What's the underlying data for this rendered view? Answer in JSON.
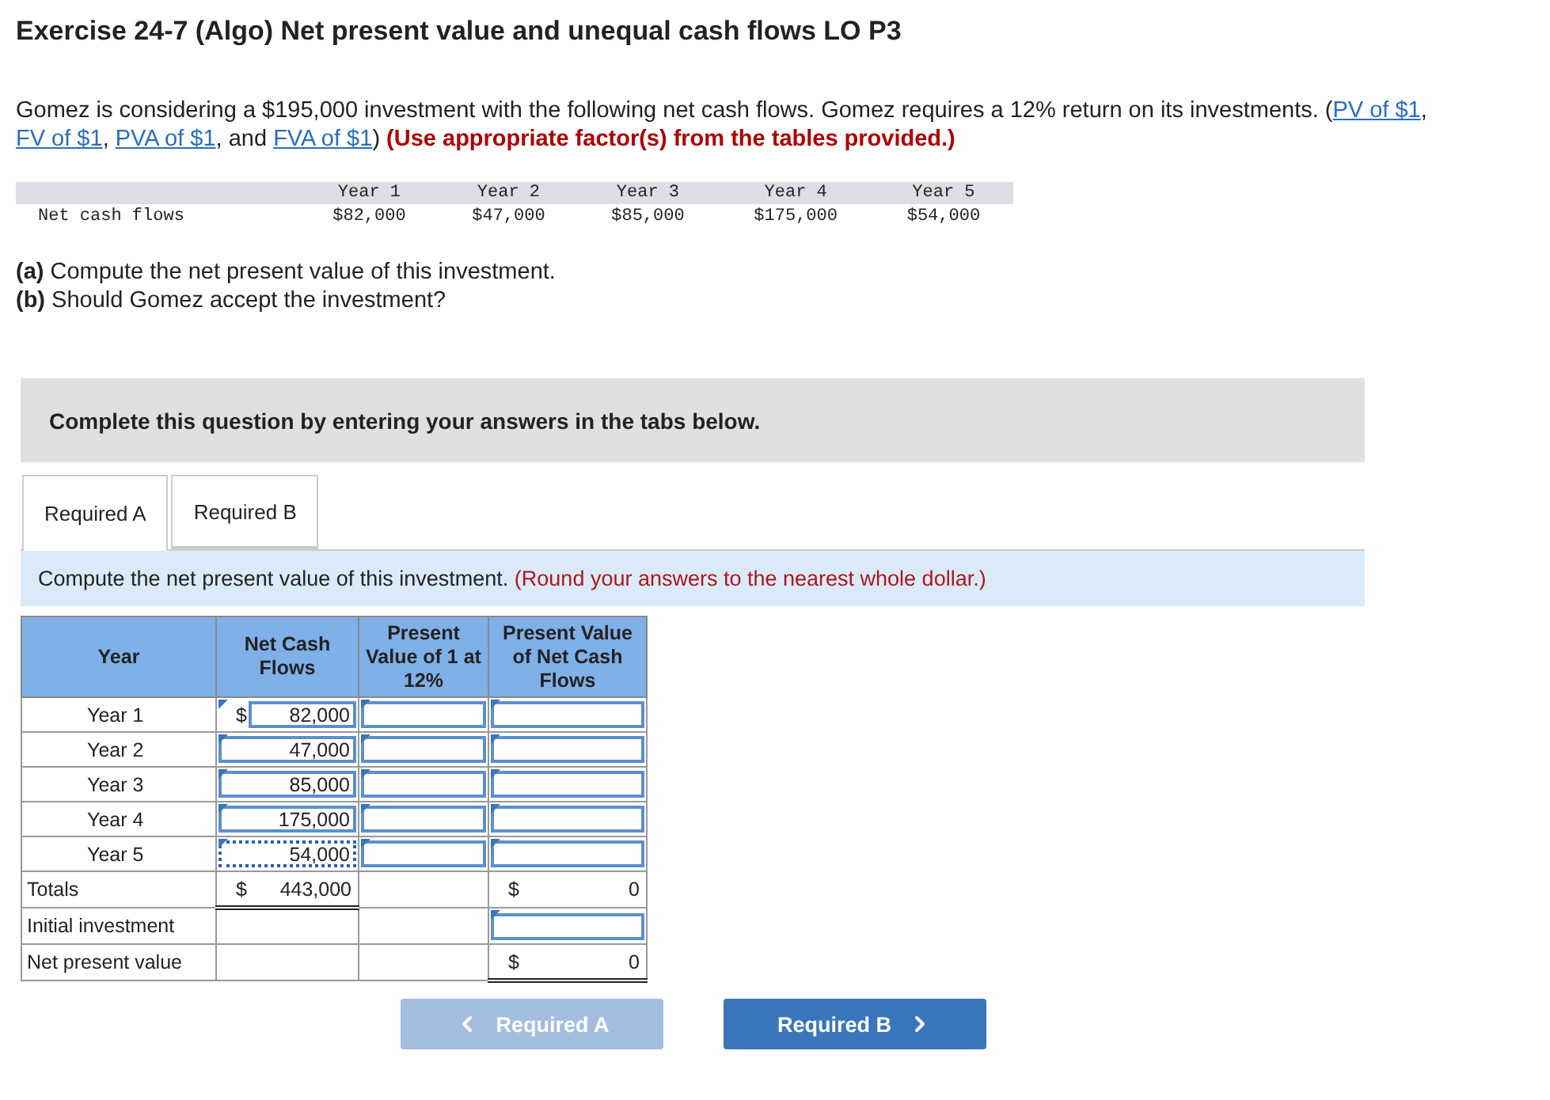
{
  "title": "Exercise 24-7 (Algo) Net present value and unequal cash flows LO P3",
  "intro": [
    {
      "kind": "text",
      "text": "Gomez is considering a $195,000 investment with the following net cash flows. Gomez requires a 12% return on its investments. ("
    },
    {
      "kind": "link",
      "text": "PV of $1"
    },
    {
      "kind": "text",
      "text": ", "
    },
    {
      "kind": "link",
      "text": "FV of $1"
    },
    {
      "kind": "text",
      "text": ", "
    },
    {
      "kind": "link",
      "text": "PVA of $1"
    },
    {
      "kind": "text",
      "text": ", and "
    },
    {
      "kind": "link",
      "text": "FVA of $1"
    },
    {
      "kind": "text",
      "text": ") "
    },
    {
      "kind": "note",
      "text": "(Use appropriate factor(s) from the tables provided.)"
    }
  ],
  "cash_flows": {
    "row_label": "Net cash flows",
    "years": [
      "Year 1",
      "Year 2",
      "Year 3",
      "Year 4",
      "Year 5"
    ],
    "values": [
      "$82,000",
      "$47,000",
      "$85,000",
      "$175,000",
      "$54,000"
    ]
  },
  "questions": [
    "**(a)** Compute the net present value of this investment.",
    "**(b)** Should Gomez accept the investment?"
  ],
  "banner": "Complete this question by entering your answers in the tabs below.",
  "tabs": [
    {
      "label": "Required A",
      "selected": true
    },
    {
      "label": "Required B",
      "selected": false
    }
  ],
  "instruction": [
    {
      "kind": "text",
      "text": "Compute the net present value of this investment. "
    },
    {
      "kind": "note",
      "text": "(Round your answers to the nearest whole dollar.)"
    }
  ],
  "answer_table": {
    "columns": [
      "Year",
      "Net Cash Flows",
      "Present Value of 1 at 12%",
      "Present Value of Net Cash Flows"
    ],
    "rows": [
      {
        "kind": "entry",
        "label": "Year 1",
        "cash_symbol": "$",
        "cash": "82,000",
        "focused": false
      },
      {
        "kind": "entry",
        "label": "Year 2",
        "cash": "47,000",
        "focused": false
      },
      {
        "kind": "entry",
        "label": "Year 3",
        "cash": "85,000",
        "focused": false
      },
      {
        "kind": "entry",
        "label": "Year 4",
        "cash": "175,000",
        "focused": false
      },
      {
        "kind": "entry",
        "label": "Year 5",
        "cash": "54,000",
        "focused": true
      },
      {
        "kind": "total",
        "label": "Totals",
        "cash_symbol": "$",
        "cash": "443,000",
        "pv_symbol": "$",
        "pv": "0"
      },
      {
        "kind": "input",
        "label": "Initial investment"
      },
      {
        "kind": "result",
        "label": "Net present value",
        "pv_symbol": "$",
        "pv": "0"
      }
    ]
  },
  "nav": [
    {
      "label": "Required A",
      "kind": "prev",
      "disabled": true
    },
    {
      "label": "Required B",
      "kind": "next",
      "disabled": false
    }
  ]
}
